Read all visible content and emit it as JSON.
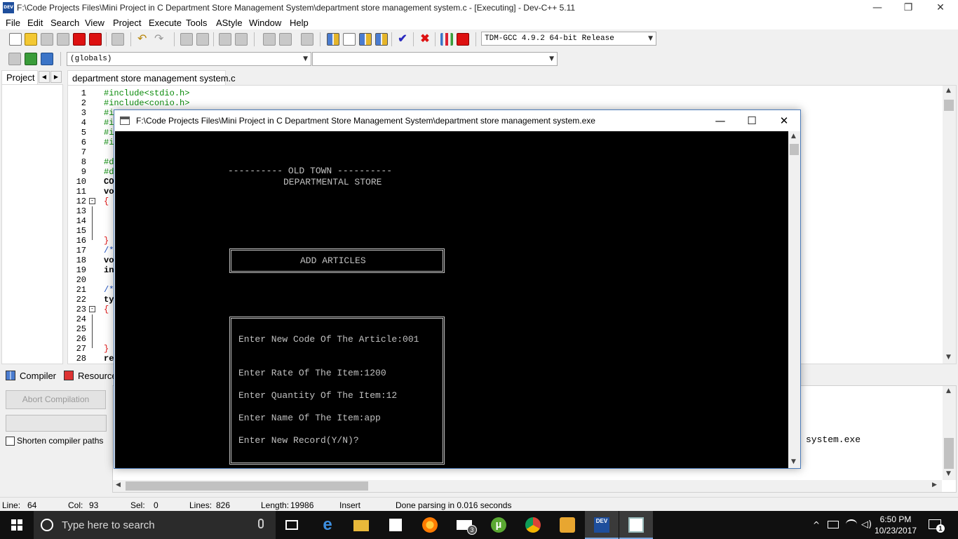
{
  "window": {
    "title": "F:\\Code Projects Files\\Mini Project in C Department Store Management System\\department store management system.c - [Executing] - Dev-C++ 5.11",
    "logo_text": "DEV",
    "minimize": "—",
    "restore": "❐",
    "close": "✕"
  },
  "menu": [
    "File",
    "Edit",
    "Search",
    "View",
    "Project",
    "Execute",
    "Tools",
    "AStyle",
    "Window",
    "Help"
  ],
  "toolbar": {
    "compiler_select": "TDM-GCC 4.9.2 64-bit Release",
    "scope_select": "(globals)",
    "member_select": ""
  },
  "left_panel": {
    "tab_label": "Project",
    "nav_prev": "◀",
    "nav_next": "▶"
  },
  "editor": {
    "tab_label": "department store management system.c",
    "line_numbers": [
      "1",
      "2",
      "3",
      "4",
      "5",
      "6",
      "7",
      "8",
      "9",
      "10",
      "11",
      "12",
      "13",
      "14",
      "15",
      "16",
      "17",
      "18",
      "19",
      "20",
      "21",
      "22",
      "23",
      "24",
      "25",
      "26",
      "27",
      "28"
    ],
    "code_lines": [
      "#include<stdio.h>",
      "#include<conio.h>",
      "#i",
      "#i",
      "#i",
      "#i",
      "",
      "#d",
      "#d",
      "CO",
      "vo",
      "{",
      "",
      "",
      "",
      "}",
      "/*",
      "vo",
      "in",
      "",
      "/*",
      "ty",
      "{",
      "",
      "",
      "",
      "}",
      "re"
    ]
  },
  "console": {
    "title": "F:\\Code Projects Files\\Mini Project in C Department Store Management System\\department store management system.exe",
    "header_line1": "---------- OLD TOWN ----------",
    "header_line2": "DEPARTMENTAL STORE",
    "section_title": "ADD ARTICLES",
    "prompts": [
      "Enter New Code Of The Article:001",
      "Enter Rate Of The Item:1200",
      "Enter Quantity Of The Item:12",
      "Enter Name Of The Item:app",
      "Enter New Record(Y/N)?"
    ],
    "minimize": "—",
    "maximize": "☐",
    "close": "✕"
  },
  "bottom_panel": {
    "tabs": [
      "Compiler",
      "Resources"
    ],
    "abort_button": "Abort Compilation",
    "shorten_paths_label": "Shorten compiler paths",
    "shorten_paths_checked": false,
    "log_text": "system.exe"
  },
  "status": {
    "line_label": "Line:",
    "line_value": "64",
    "col_label": "Col:",
    "col_value": "93",
    "sel_label": "Sel:",
    "sel_value": "0",
    "lines_label": "Lines:",
    "lines_value": "826",
    "length_label": "Length:",
    "length_value": "19986",
    "mode": "Insert",
    "message": "Done parsing in 0.016 seconds"
  },
  "taskbar": {
    "search_placeholder": "Type here to search",
    "mail_badge": "3",
    "clock_time": "6:50 PM",
    "clock_date": "10/23/2017",
    "notification_count": "1"
  },
  "colors": {
    "console_bg": "#000000",
    "console_text": "#c0c0c0",
    "taskbar_bg": "#101010",
    "include_green": "#0a8a0a",
    "brace_red": "#dd1111"
  }
}
